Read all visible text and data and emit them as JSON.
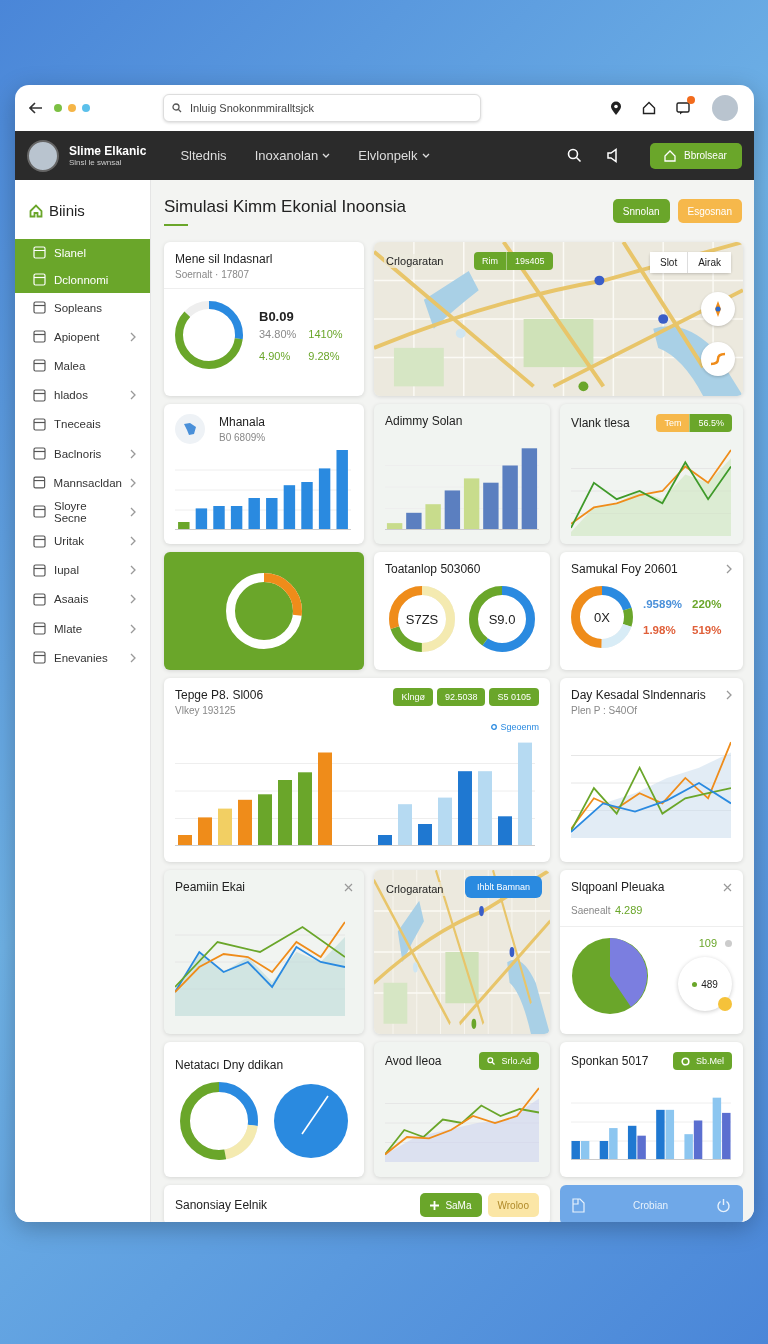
{
  "browser": {
    "url": "Inluig Snokonmmiralltsjck"
  },
  "header": {
    "brand_name": "Slime Elkanic",
    "brand_tagline": "Slnsl le swnsal",
    "nav": [
      {
        "label": "Sltednis",
        "dropdown": false
      },
      {
        "label": "Inoxanolan",
        "dropdown": true
      },
      {
        "label": "Elvlonpelk",
        "dropdown": true
      }
    ],
    "action_button": "Bbrolsear"
  },
  "sidebar": {
    "title": "Biinis",
    "items": [
      {
        "label": "Slanel",
        "selected": true,
        "expandable": false
      },
      {
        "label": "Dclonnomi",
        "selected": true,
        "expandable": false
      },
      {
        "label": "Sopleans",
        "selected": false,
        "expandable": false
      },
      {
        "label": "Apiopent",
        "selected": false,
        "expandable": true
      },
      {
        "label": "Malea",
        "selected": false,
        "expandable": false
      },
      {
        "label": "hlados",
        "selected": false,
        "expandable": true
      },
      {
        "label": "Tneceais",
        "selected": false,
        "expandable": false
      },
      {
        "label": "Baclnoris",
        "selected": false,
        "expandable": true
      },
      {
        "label": "Mannsacldan",
        "selected": false,
        "expandable": true
      },
      {
        "label": "Sloyre Secne",
        "selected": false,
        "expandable": true
      },
      {
        "label": "Uritak",
        "selected": false,
        "expandable": true
      },
      {
        "label": "Iupal",
        "selected": false,
        "expandable": true
      },
      {
        "label": "Asaais",
        "selected": false,
        "expandable": true
      },
      {
        "label": "Mlate",
        "selected": false,
        "expandable": true
      },
      {
        "label": "Enevanies",
        "selected": false,
        "expandable": true
      }
    ]
  },
  "page": {
    "title": "Simulasi Kimm Ekonial Inoonsia",
    "buttons": [
      {
        "label": "Snnolan",
        "kind": "primary"
      },
      {
        "label": "Esgosnan",
        "kind": "warning"
      }
    ]
  },
  "overview_card": {
    "title": "Mene sil Indasnarl",
    "subtitle": "Soernalt · 17807",
    "value": "B0.09",
    "stats": [
      {
        "text": "34.80%",
        "color": "#8a8a8a"
      },
      {
        "text": "1410%",
        "color": "#6aa62a"
      },
      {
        "text": "4.90%",
        "color": "#6aa62a"
      },
      {
        "text": "9.28%",
        "color": "#6aa62a"
      }
    ]
  },
  "map_top": {
    "label": "Crlogaratan",
    "chips": [
      "Rim",
      "19s405"
    ],
    "toggle": [
      {
        "label": "Slot",
        "selected": false
      },
      {
        "label": "Airak",
        "selected": false
      }
    ]
  },
  "growth_card": {
    "title": "Mhanala",
    "subtitle": "B0 6809%"
  },
  "bar_card": {
    "title": "Adimmy Solan"
  },
  "trend_card": {
    "title": "Vlank tlesa",
    "chips": [
      {
        "label": "Tem",
        "kind": "warning"
      },
      {
        "label": "56.5%",
        "kind": "primary"
      }
    ]
  },
  "ring_card": {
    "title": "Toatanlop 503060",
    "rings": [
      "S7ZS",
      "S9.0"
    ]
  },
  "split_card": {
    "title": "Samukal Foy 20601",
    "center": "0X",
    "stats": [
      {
        "text": ".9589%",
        "color": "#4a90d9"
      },
      {
        "text": "220%",
        "color": "#6aa62a"
      },
      {
        "text": "1.98%",
        "color": "#e0603a"
      },
      {
        "text": "519%",
        "color": "#e0603a"
      }
    ]
  },
  "wide_bar_card": {
    "title": "Tepge P8. Sl006",
    "subtitle": "Vlkey 193125",
    "chips": [
      "Klngø",
      "92.5038",
      "S5 0105"
    ],
    "legend": "Sgeoenm"
  },
  "line_card": {
    "title": "Day Kesadal Slndennaris",
    "subtitle": "Plen P : S40Of"
  },
  "area_card": {
    "title": "Peamiin Ekai"
  },
  "map_bottom": {
    "label": "Crlogaratan",
    "button": "Ihblt Bamnan"
  },
  "pie_card": {
    "title": "Slqpoanl Pleuaka",
    "subtitle": "Saenealt",
    "value": "4.289",
    "legend_value": "109",
    "badge_value": "489"
  },
  "donut_pair_card": {
    "title": "Netatacı Dny ddikan"
  },
  "avod_card": {
    "title": "Avod Ileoa",
    "button": "Srlo.Ad"
  },
  "grouped_bar_card": {
    "title": "Sponkan 5017",
    "button": "Sb.Mel"
  },
  "footer_card": {
    "title": "Sanonsiay Eelnik",
    "buttons": [
      {
        "label": "SaMa",
        "kind": "primary"
      },
      {
        "label": "Wroloo",
        "kind": "disabled"
      }
    ]
  },
  "footer_bar": {
    "label": "Crobian"
  }
}
